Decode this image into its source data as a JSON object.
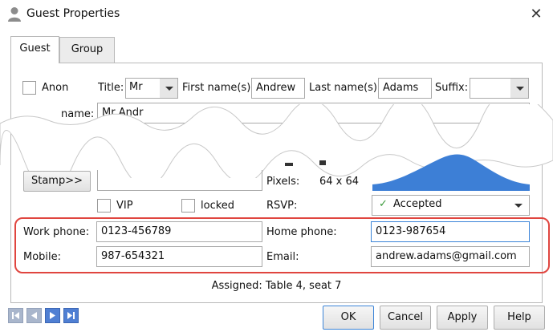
{
  "window": {
    "title": "Guest Properties",
    "close_symbol": "✕"
  },
  "tabs": [
    {
      "label": "Guest",
      "active": true
    },
    {
      "label": "Group",
      "active": false
    }
  ],
  "name_row": {
    "anon_label": "Anon",
    "title_label": "Title:",
    "title_value": "Mr",
    "first_name_label": "First name(s):",
    "first_name_value": "Andrew",
    "last_name_label": "Last name(s):",
    "last_name_value": "Adams",
    "suffix_label": "Suffix:",
    "suffix_value": ""
  },
  "display_name": {
    "label_partial": "name:",
    "value_partial": "Mr Andr"
  },
  "image_row": {
    "stamp_button": "Stamp>>",
    "pixels_label": "Pixels:",
    "pixels_value": "64 x 64"
  },
  "flags": {
    "vip_label": "VIP",
    "locked_label": "locked",
    "rsvp_label": "RSVP:",
    "rsvp_check": "✓",
    "rsvp_value": "Accepted"
  },
  "contacts": {
    "work_phone_label": "Work phone:",
    "work_phone_value": "0123-456789",
    "home_phone_label": "Home phone:",
    "home_phone_value": "0123-987654",
    "mobile_label": "Mobile:",
    "mobile_value": "987-654321",
    "email_label": "Email:",
    "email_value": "andrew.adams@gmail.com"
  },
  "assigned_text": "Assigned: Table 4, seat 7",
  "footer": {
    "ok": "OK",
    "cancel": "Cancel",
    "apply": "Apply",
    "help": "Help"
  },
  "colors": {
    "accent": "#3b84d8",
    "highlight": "#e0453f",
    "image_fill": "#3d7fd6"
  }
}
